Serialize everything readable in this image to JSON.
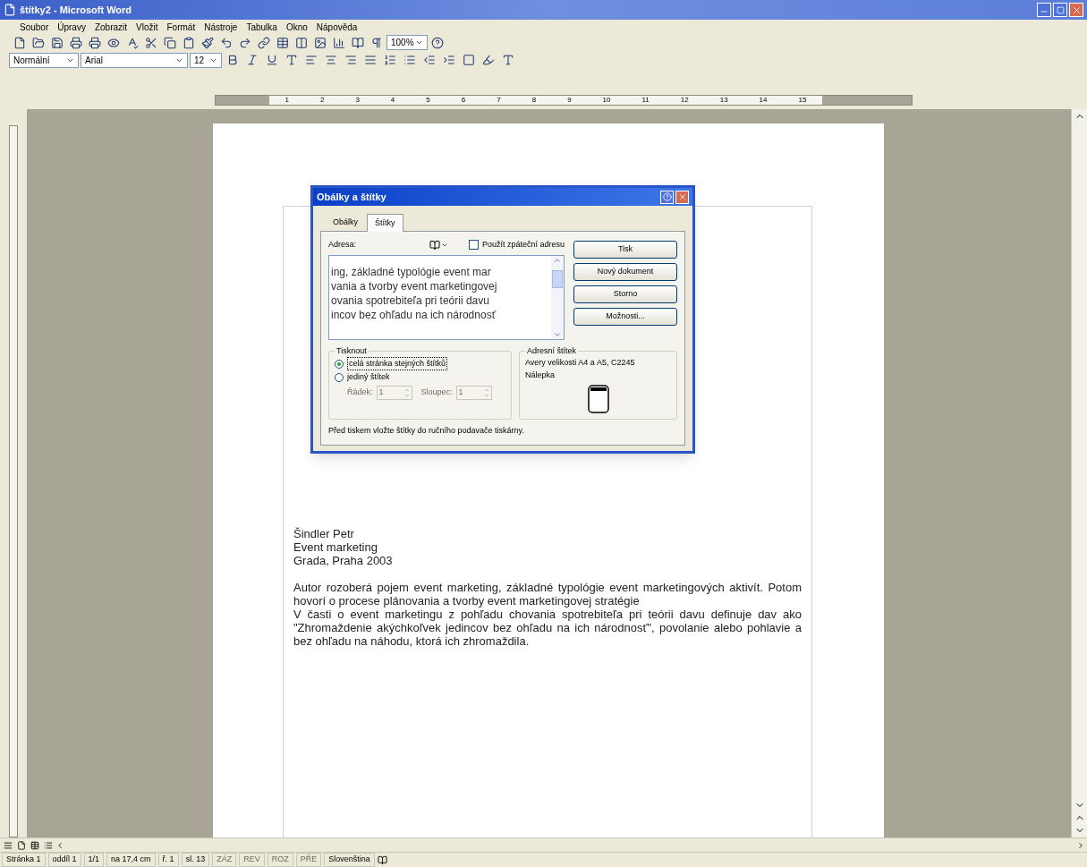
{
  "window": {
    "title": "štítky2 - Microsoft Word"
  },
  "menu": [
    "Soubor",
    "Úpravy",
    "Zobrazit",
    "Vložit",
    "Formát",
    "Nástroje",
    "Tabulka",
    "Okno",
    "Nápověda"
  ],
  "toolbar": {
    "zoom": "100%",
    "style": "Normální",
    "font": "Arial",
    "size": "12"
  },
  "ruler": {
    "labels": [
      "1",
      "2",
      "3",
      "4",
      "5",
      "6",
      "7",
      "8",
      "9",
      "10",
      "11",
      "12",
      "13",
      "14",
      "15"
    ]
  },
  "document": {
    "lines": [
      "Šindler Petr",
      "Event marketing",
      "Grada, Praha 2003"
    ],
    "paragraphs": [
      "Autor rozoberá pojem event marketing, základné typológie event marketingových aktivít. Potom hovorí o procese plánovania a tvorby event marketingovej stratégie",
      "V časti o event marketingu z pohľadu chovania spotrebiteľa pri teórii davu definuje dav ako \"Zhromaždenie akýchkoľvek jedincov bez ohľadu na ich národnosť\", povolanie alebo pohlavie a bez ohľadu na náhodu, ktorá ich zhromaždila."
    ]
  },
  "dialog": {
    "title": "Obálky a štítky",
    "tabs": [
      {
        "label": "Obálky",
        "selected": false
      },
      {
        "label": "Štítky",
        "selected": true
      }
    ],
    "address_label": "Adresa:",
    "return_address": {
      "label": "Použít zpáteční adresu",
      "checked": false
    },
    "address_lines": [
      "ing, základné typológie event mar",
      "vania a tvorby event marketingovej",
      "ovania spotrebiteľa pri teórii davu",
      "incov bez ohľadu na ich národnosť"
    ],
    "buttons": [
      "Tisk",
      "Nový dokument",
      "Storno",
      "Možnosti..."
    ],
    "print_group": {
      "title": "Tisknout",
      "options": [
        {
          "label": "celá stránka stejných štítků",
          "selected": true
        },
        {
          "label": "jediný štítek",
          "selected": false
        }
      ],
      "row_label": "Řádek:",
      "row_value": "1",
      "column_label": "Sloupec:",
      "column_value": "1",
      "disabled": true
    },
    "label_group": {
      "title": "Adresní štítek",
      "lines": [
        "Avery velikosti A4 a A5, C2245",
        "Nálepka"
      ]
    },
    "note": "Před tiskem vložte štítky do ručního podavače tiskárny."
  },
  "status_bar": [
    {
      "text": "Stránka 1",
      "disabled": false
    },
    {
      "text": "oddíl 1",
      "disabled": false
    },
    {
      "text": "1/1",
      "disabled": false
    },
    {
      "text": "na 17,4 cm",
      "disabled": false
    },
    {
      "text": "ř. 1",
      "disabled": false
    },
    {
      "text": "sl. 13",
      "disabled": false
    },
    {
      "text": "ZÁZ",
      "disabled": true
    },
    {
      "text": "REV",
      "disabled": true
    },
    {
      "text": "ROZ",
      "disabled": true
    },
    {
      "text": "PŘE",
      "disabled": true
    },
    {
      "text": "Slovenština",
      "disabled": false
    }
  ]
}
